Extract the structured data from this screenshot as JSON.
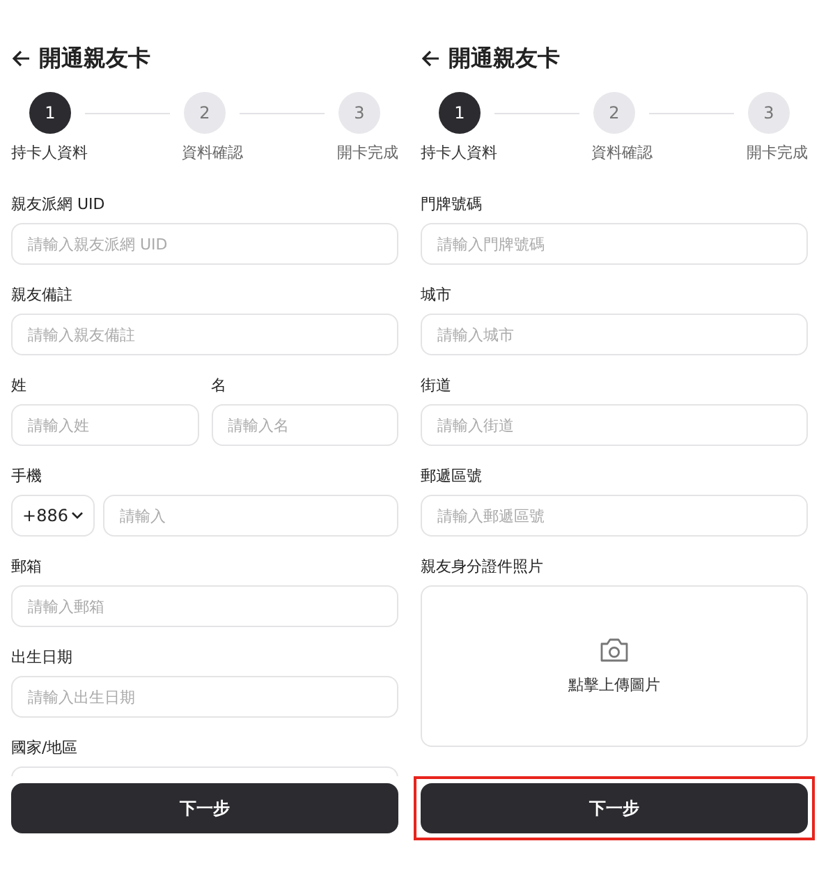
{
  "screens": [
    {
      "title": "開通親友卡",
      "steps": [
        {
          "number": "1",
          "label": "持卡人資料",
          "active": true
        },
        {
          "number": "2",
          "label": "資料確認",
          "active": false
        },
        {
          "number": "3",
          "label": "開卡完成",
          "active": false
        }
      ],
      "fields": [
        {
          "kind": "text",
          "label": "親友派網 UID",
          "placeholder": "請輸入親友派網 UID"
        },
        {
          "kind": "text",
          "label": "親友備註",
          "placeholder": "請輸入親友備註"
        },
        {
          "kind": "pair",
          "items": [
            {
              "label": "姓",
              "placeholder": "請輸入姓"
            },
            {
              "label": "名",
              "placeholder": "請輸入名"
            }
          ]
        },
        {
          "kind": "phone",
          "label": "手機",
          "code": "+886",
          "placeholder": "請輸入"
        },
        {
          "kind": "text",
          "label": "郵箱",
          "placeholder": "請輸入郵箱"
        },
        {
          "kind": "text",
          "label": "出生日期",
          "placeholder": "請輸入出生日期"
        },
        {
          "kind": "partial",
          "label": "國家/地區"
        }
      ],
      "button": {
        "label": "下一步",
        "highlighted": false
      }
    },
    {
      "title": "開通親友卡",
      "steps": [
        {
          "number": "1",
          "label": "持卡人資料",
          "active": true
        },
        {
          "number": "2",
          "label": "資料確認",
          "active": false
        },
        {
          "number": "3",
          "label": "開卡完成",
          "active": false
        }
      ],
      "fields": [
        {
          "kind": "text",
          "label": "門牌號碼",
          "placeholder": "請輸入門牌號碼"
        },
        {
          "kind": "text",
          "label": "城市",
          "placeholder": "請輸入城市"
        },
        {
          "kind": "text",
          "label": "街道",
          "placeholder": "請輸入街道"
        },
        {
          "kind": "text",
          "label": "郵遞區號",
          "placeholder": "請輸入郵遞區號"
        },
        {
          "kind": "upload",
          "label": "親友身分證件照片",
          "text": "點擊上傳圖片"
        }
      ],
      "button": {
        "label": "下一步",
        "highlighted": true
      }
    }
  ]
}
